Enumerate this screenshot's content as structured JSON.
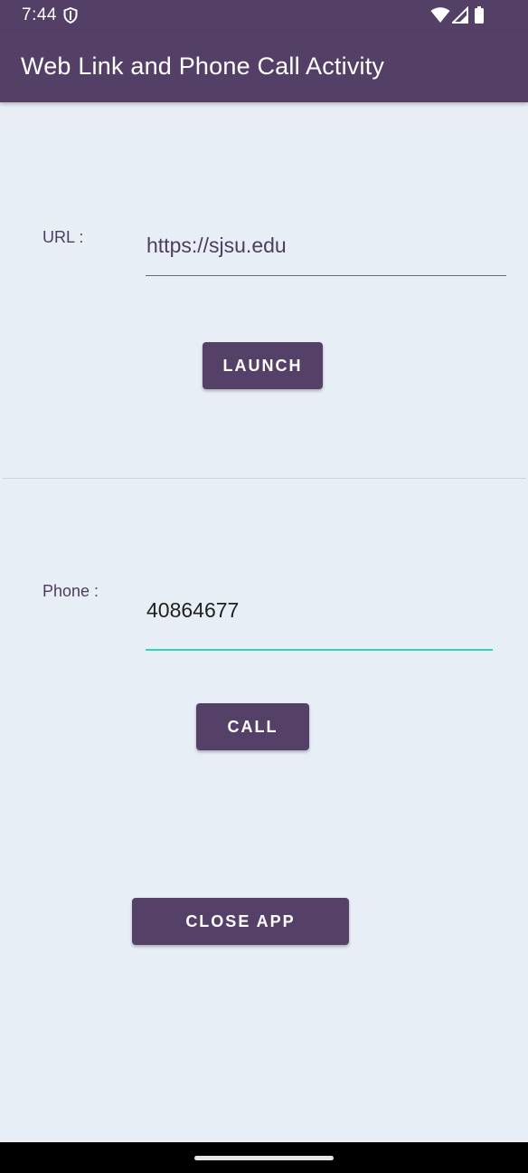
{
  "status_bar": {
    "time": "7:44"
  },
  "app_bar": {
    "title": "Web Link and Phone Call Activity"
  },
  "url_section": {
    "label": "URL :",
    "value": "https://sjsu.edu",
    "button_label": "LAUNCH"
  },
  "phone_section": {
    "label": "Phone :",
    "value": "40864677",
    "button_label": "CALL"
  },
  "close_button_label": "CLOSE APP",
  "colors": {
    "primary": "#544067",
    "background": "#e8eef6",
    "focused_underline": "#2ad4bd"
  }
}
